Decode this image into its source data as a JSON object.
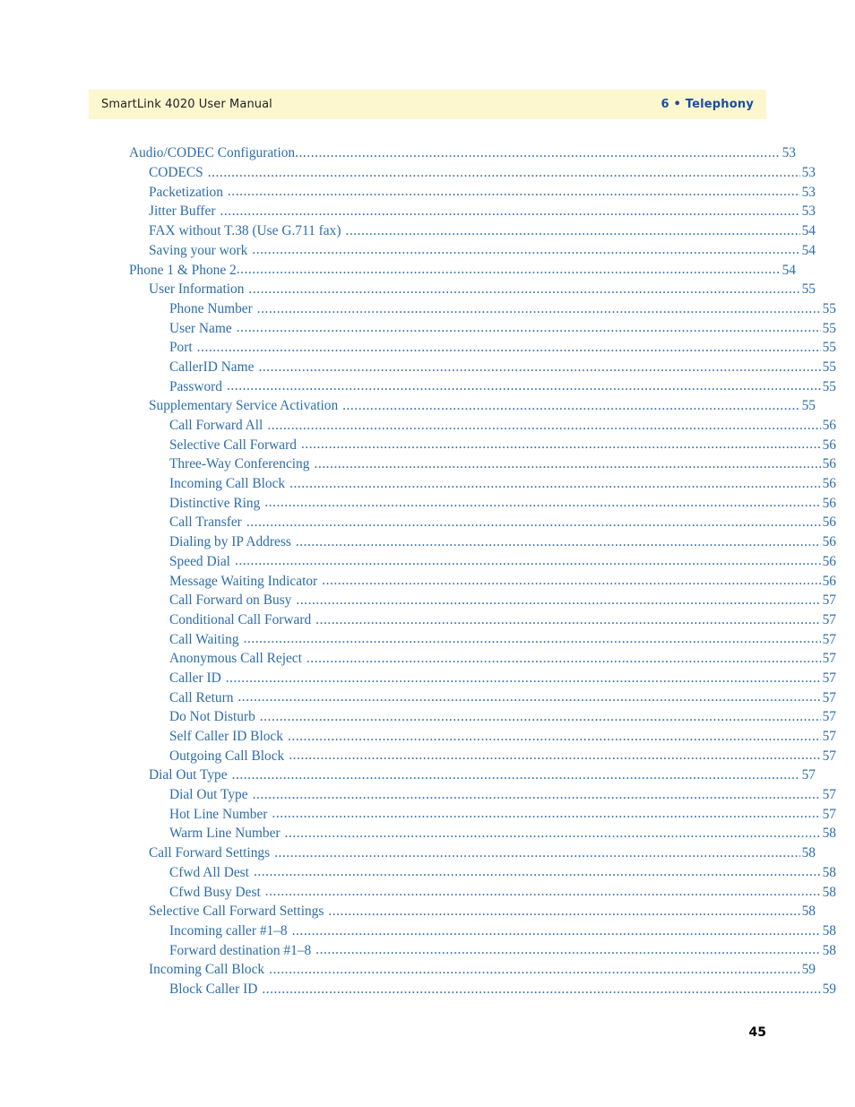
{
  "header": {
    "manual_title": "SmartLink 4020 User Manual",
    "chapter_label": "6 • Telephony",
    "band_color": "#FCF7CE",
    "chapter_color": "#1B4E9B",
    "title_color": "#231f20"
  },
  "folio": {
    "page_number": "45"
  },
  "toc": {
    "link_color": "#2E6DAA",
    "entries": [
      {
        "label": "Audio/CODEC Configuration",
        "page": "53",
        "level": 1,
        "gap": false
      },
      {
        "label": "CODECS",
        "page": "53",
        "level": 2,
        "gap": true
      },
      {
        "label": "Packetization",
        "page": "53",
        "level": 2,
        "gap": true
      },
      {
        "label": "Jitter Buffer",
        "page": "53",
        "level": 2,
        "gap": true
      },
      {
        "label": "FAX without T.38 (Use G.711 fax)",
        "page": "54",
        "level": 2,
        "gap": true
      },
      {
        "label": "Saving your work",
        "page": "54",
        "level": 2,
        "gap": true
      },
      {
        "label": "Phone 1 & Phone 2",
        "page": "54",
        "level": 1,
        "gap": false
      },
      {
        "label": "User Information",
        "page": "55",
        "level": 2,
        "gap": true
      },
      {
        "label": "Phone Number",
        "page": "55",
        "level": 3,
        "gap": true
      },
      {
        "label": "User Name",
        "page": "55",
        "level": 3,
        "gap": true
      },
      {
        "label": "Port",
        "page": "55",
        "level": 3,
        "gap": true
      },
      {
        "label": "CallerID Name",
        "page": "55",
        "level": 3,
        "gap": true
      },
      {
        "label": "Password",
        "page": "55",
        "level": 3,
        "gap": true
      },
      {
        "label": "Supplementary Service Activation",
        "page": "55",
        "level": 2,
        "gap": true
      },
      {
        "label": "Call Forward All",
        "page": "56",
        "level": 3,
        "gap": true
      },
      {
        "label": "Selective Call Forward",
        "page": "56",
        "level": 3,
        "gap": true
      },
      {
        "label": "Three-Way Conferencing",
        "page": "56",
        "level": 3,
        "gap": true
      },
      {
        "label": "Incoming Call Block",
        "page": "56",
        "level": 3,
        "gap": true
      },
      {
        "label": "Distinctive Ring",
        "page": "56",
        "level": 3,
        "gap": true
      },
      {
        "label": "Call Transfer",
        "page": "56",
        "level": 3,
        "gap": true
      },
      {
        "label": "Dialing by IP Address",
        "page": "56",
        "level": 3,
        "gap": true
      },
      {
        "label": "Speed Dial",
        "page": "56",
        "level": 3,
        "gap": true
      },
      {
        "label": "Message Waiting Indicator",
        "page": "56",
        "level": 3,
        "gap": true
      },
      {
        "label": "Call Forward on Busy",
        "page": "57",
        "level": 3,
        "gap": true
      },
      {
        "label": "Conditional Call Forward",
        "page": "57",
        "level": 3,
        "gap": true
      },
      {
        "label": "Call Waiting",
        "page": "57",
        "level": 3,
        "gap": true
      },
      {
        "label": "Anonymous Call Reject",
        "page": "57",
        "level": 3,
        "gap": true
      },
      {
        "label": "Caller ID",
        "page": "57",
        "level": 3,
        "gap": true
      },
      {
        "label": "Call Return",
        "page": "57",
        "level": 3,
        "gap": true
      },
      {
        "label": "Do Not Disturb",
        "page": "57",
        "level": 3,
        "gap": true
      },
      {
        "label": "Self Caller ID Block",
        "page": "57",
        "level": 3,
        "gap": true
      },
      {
        "label": "Outgoing Call Block",
        "page": "57",
        "level": 3,
        "gap": true
      },
      {
        "label": "Dial Out Type",
        "page": "57",
        "level": 2,
        "gap": true
      },
      {
        "label": "Dial Out Type",
        "page": "57",
        "level": 3,
        "gap": true
      },
      {
        "label": "Hot Line Number",
        "page": "57",
        "level": 3,
        "gap": true
      },
      {
        "label": "Warm Line Number",
        "page": "58",
        "level": 3,
        "gap": true
      },
      {
        "label": "Call Forward Settings",
        "page": "58",
        "level": 2,
        "gap": true
      },
      {
        "label": "Cfwd All Dest",
        "page": "58",
        "level": 3,
        "gap": true
      },
      {
        "label": "Cfwd Busy Dest",
        "page": "58",
        "level": 3,
        "gap": true
      },
      {
        "label": "Selective Call Forward Settings",
        "page": "58",
        "level": 2,
        "gap": true
      },
      {
        "label": "Incoming caller #1–8",
        "page": "58",
        "level": 3,
        "gap": true
      },
      {
        "label": "Forward destination #1–8",
        "page": "58",
        "level": 3,
        "gap": true
      },
      {
        "label": "Incoming Call Block",
        "page": "59",
        "level": 2,
        "gap": true
      },
      {
        "label": "Block Caller ID",
        "page": "59",
        "level": 3,
        "gap": true
      }
    ]
  }
}
